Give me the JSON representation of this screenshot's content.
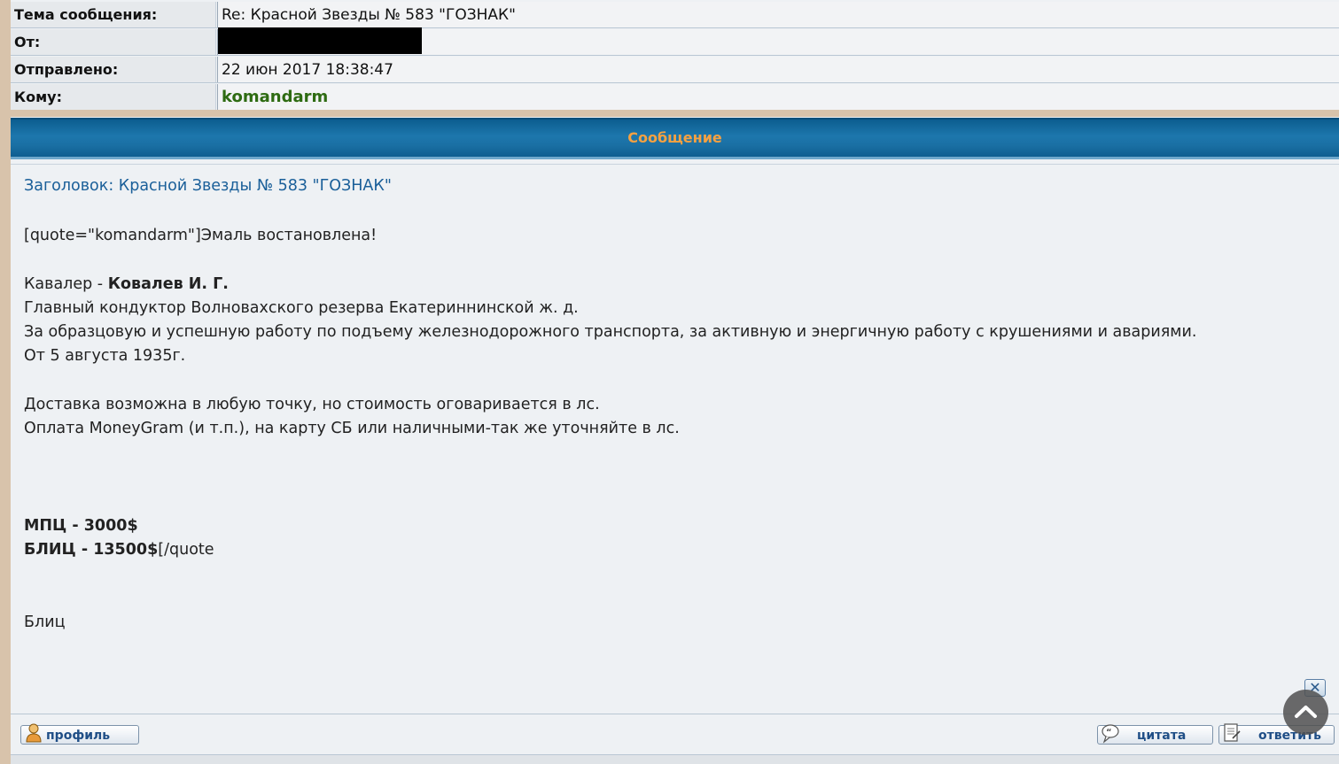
{
  "header": {
    "subject_label": "Тема сообщения:",
    "subject_value": "Re: Красной Звезды № 583 \"ГОЗНАК\"",
    "from_label": "От:",
    "sent_label": "Отправлено:",
    "sent_value": "22 июн 2017 18:38:47",
    "to_label": "Кому:",
    "to_value": "komandarm"
  },
  "section_title": "Сообщение",
  "message": {
    "title": "Заголовок: Красной Звезды № 583 \"ГОЗНАК\"",
    "lines": {
      "l1": "[quote=\"komandarm\"]Эмаль востановлена!",
      "l2a": "Кавалер - ",
      "l2b": "Ковалев И. Г.",
      "l3": "Главный кондуктор Волновахского резерва Екатериннинской ж. д.",
      "l4": "За образцовую и успешную работу по подъему железнодорожного транспорта, за активную и энергичную работу с крушениями и авариями.",
      "l5": "От 5 августа 1935г.",
      "l6": "Доставка возможна в любую точку, но стоимость оговаривается в лс.",
      "l7": "Оплата MoneyGram (и т.п.), на карту СБ или наличными-так же уточняйте в лс.",
      "l8": "МПЦ - 3000$",
      "l9a": "БЛИЦ - 13500$",
      "l9b": "[/quote",
      "l10": "Блиц"
    }
  },
  "buttons": {
    "profile": "профиль",
    "quote": "цитата",
    "reply": "ответить"
  },
  "icons": {
    "profile": "user-icon",
    "quote": "quote-bubble-icon",
    "reply": "reply-doc-icon",
    "close": "close-icon",
    "scroll_top": "chevron-up-icon"
  },
  "colors": {
    "accent_header": "#1a6fa3",
    "section_title": "#f5a142",
    "username": "#2e6b12"
  }
}
